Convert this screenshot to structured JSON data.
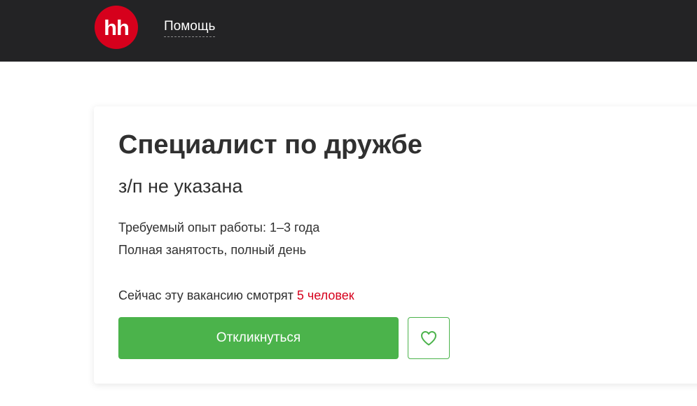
{
  "header": {
    "logo_text": "hh",
    "help_link": "Помощь"
  },
  "vacancy": {
    "title": "Специалист по дружбе",
    "salary": "з/п не указана",
    "experience": "Требуемый опыт работы: 1–3 года",
    "employment": "Полная занятость, полный день",
    "viewers_prefix": "Сейчас эту вакансию смотрят ",
    "viewers_count": "5 человек"
  },
  "actions": {
    "respond_label": "Откликнуться",
    "favorite_icon": "heart-outline-icon"
  },
  "colors": {
    "header_bg": "#232325",
    "brand_red": "#d6001c",
    "accent_green": "#4bb34b",
    "text": "#303030"
  }
}
